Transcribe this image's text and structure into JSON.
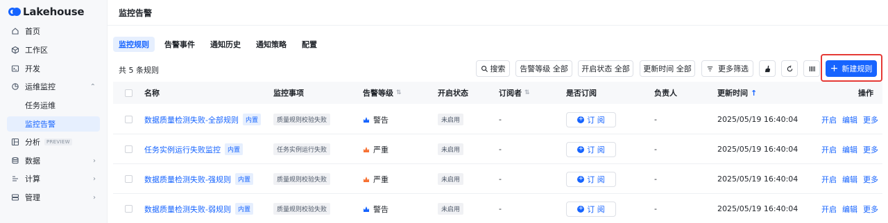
{
  "app": {
    "brand": "Lakehouse"
  },
  "sidebar": {
    "items": [
      {
        "label": "首页",
        "icon": "home-icon"
      },
      {
        "label": "工作区",
        "icon": "cube-icon"
      },
      {
        "label": "开发",
        "icon": "terminal-icon"
      },
      {
        "label": "运维监控",
        "icon": "monitor-icon",
        "expanded": true
      },
      {
        "label": "任务运维"
      },
      {
        "label": "监控告警",
        "active": true
      },
      {
        "label": "分析",
        "icon": "analysis-icon",
        "badge": "PREVIEW"
      },
      {
        "label": "数据",
        "icon": "database-icon"
      },
      {
        "label": "计算",
        "icon": "compute-icon"
      },
      {
        "label": "管理",
        "icon": "manage-icon"
      }
    ]
  },
  "page": {
    "title": "监控告警"
  },
  "tabs": [
    {
      "label": "监控规则",
      "active": true
    },
    {
      "label": "告警事件"
    },
    {
      "label": "通知历史"
    },
    {
      "label": "通知策略"
    },
    {
      "label": "配置"
    }
  ],
  "toolbar": {
    "count_text": "共 5 条规则",
    "search_label": "搜索",
    "alert_level_filter": "告警等级 全部",
    "enable_status_filter": "开启状态 全部",
    "update_time_filter": "更新时间 全部",
    "more_filters": "更多筛选",
    "new_rule_label": "新建规则"
  },
  "table": {
    "columns": [
      "名称",
      "监控事项",
      "告警等级",
      "开启状态",
      "订阅者",
      "是否订阅",
      "负责人",
      "更新时间",
      "操作"
    ],
    "builtin_tag": "内置",
    "subscribe_label": "订 阅",
    "actions": [
      "开启",
      "编辑",
      "更多"
    ],
    "rows": [
      {
        "name": "数据质量检测失败-全部规则",
        "item": "质量规则校验失败",
        "level": "警告",
        "level_color": "#1664ff",
        "status": "未启用",
        "subscriber": "-",
        "owner": "-",
        "updated": "2025/05/19 16:40:04"
      },
      {
        "name": "任务实例运行失败监控",
        "item": "任务实例运行失败",
        "level": "严重",
        "level_color": "#f77234",
        "status": "未启用",
        "subscriber": "-",
        "owner": "-",
        "updated": "2025/05/19 16:40:04"
      },
      {
        "name": "数据质量检测失败-强规则",
        "item": "质量规则校验失败",
        "level": "严重",
        "level_color": "#f77234",
        "status": "未启用",
        "subscriber": "-",
        "owner": "-",
        "updated": "2025/05/19 16:40:04"
      },
      {
        "name": "数据质量检测失败-弱规则",
        "item": "质量规则校验失败",
        "level": "警告",
        "level_color": "#1664ff",
        "status": "未启用",
        "subscriber": "-",
        "owner": "-",
        "updated": "2025/05/19 16:40:04"
      }
    ]
  }
}
